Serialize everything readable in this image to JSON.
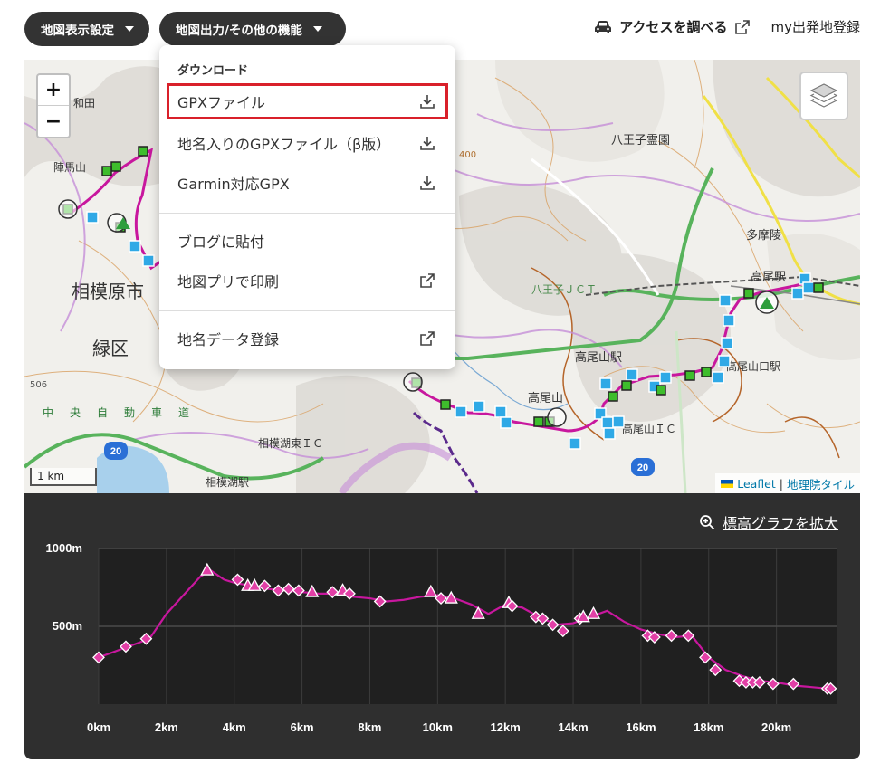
{
  "toolbar": {
    "map_settings_label": "地図表示設定",
    "output_label": "地図出力/その他の機能",
    "access_label": "アクセスを調べる",
    "my_start_label": "my出発地登録"
  },
  "map": {
    "zoom_in": "+",
    "zoom_out": "−",
    "scale_label": "1 km",
    "attribution": {
      "leaflet": "Leaflet",
      "separator": "|",
      "tiles": "地理院タイル"
    },
    "labels": [
      "八王子霊園",
      "多摩陵",
      "相模原市",
      "緑区",
      "高尾駅",
      "八王子ＪＣＴ",
      "高尾山駅",
      "高尾山",
      "高尾山口駅",
      "高尾山ＩＣ",
      "相模湖東ＩＣ",
      "相模湖駅",
      "中央自動車道",
      "陣馬山",
      "和田",
      "400",
      "506",
      "20",
      "20"
    ]
  },
  "dropdown": {
    "heading": "ダウンロード",
    "items": [
      {
        "label": "GPXファイル",
        "icon": "download-icon"
      },
      {
        "label": "地名入りのGPXファイル（β版）",
        "icon": "download-icon"
      },
      {
        "label": "Garmin対応GPX",
        "icon": "download-icon"
      },
      {
        "label": "ブログに貼付",
        "icon": ""
      },
      {
        "label": "地図プリで印刷",
        "icon": "external-link-icon"
      },
      {
        "label": "地名データ登録",
        "icon": "external-link-icon"
      }
    ]
  },
  "profile": {
    "enlarge_label": "標高グラフを拡大"
  },
  "chart_data": {
    "type": "line",
    "ylim": [
      0,
      1000
    ],
    "xlim": [
      0,
      21.8
    ],
    "yticks": [
      "1000m",
      "500m"
    ],
    "ytick_values": [
      1000,
      500
    ],
    "xticks": [
      "0km",
      "2km",
      "4km",
      "6km",
      "8km",
      "10km",
      "12km",
      "14km",
      "16km",
      "18km",
      "20km"
    ],
    "xtick_values": [
      0,
      2,
      4,
      6,
      8,
      10,
      12,
      14,
      16,
      18,
      20
    ],
    "series": [
      {
        "x": [
          0,
          0.5,
          1.0,
          1.5,
          2.0,
          2.5,
          3.0,
          3.3,
          3.7,
          4.0,
          4.5,
          5.0,
          5.5,
          6.0,
          6.5,
          7.0,
          7.5,
          8.0,
          8.5,
          9.0,
          9.5,
          10.0,
          10.5,
          11.0,
          11.5,
          12.0,
          12.5,
          13.0,
          13.5,
          14.0,
          14.5,
          15.0,
          15.5,
          16.0,
          16.5,
          17.0,
          17.5,
          18.0,
          18.5,
          19.0,
          19.5,
          20.0,
          20.5,
          21.0,
          21.5
        ],
        "y": [
          300,
          340,
          380,
          420,
          580,
          700,
          820,
          860,
          800,
          780,
          760,
          740,
          730,
          720,
          710,
          710,
          690,
          680,
          660,
          670,
          690,
          700,
          680,
          640,
          580,
          640,
          620,
          560,
          510,
          520,
          560,
          600,
          530,
          480,
          450,
          430,
          440,
          300,
          220,
          180,
          150,
          140,
          120,
          110,
          100
        ]
      }
    ],
    "markers": [
      {
        "x": 0,
        "y": 300,
        "shape": "diamond"
      },
      {
        "x": 0.8,
        "y": 370,
        "shape": "diamond"
      },
      {
        "x": 1.4,
        "y": 420,
        "shape": "diamond"
      },
      {
        "x": 3.2,
        "y": 860,
        "shape": "triangle"
      },
      {
        "x": 4.1,
        "y": 800,
        "shape": "diamond"
      },
      {
        "x": 4.4,
        "y": 760,
        "shape": "triangle"
      },
      {
        "x": 4.6,
        "y": 760,
        "shape": "triangle"
      },
      {
        "x": 4.9,
        "y": 760,
        "shape": "diamond"
      },
      {
        "x": 5.3,
        "y": 730,
        "shape": "diamond"
      },
      {
        "x": 5.6,
        "y": 740,
        "shape": "diamond"
      },
      {
        "x": 5.9,
        "y": 730,
        "shape": "diamond"
      },
      {
        "x": 6.3,
        "y": 720,
        "shape": "triangle"
      },
      {
        "x": 6.9,
        "y": 720,
        "shape": "diamond"
      },
      {
        "x": 7.2,
        "y": 730,
        "shape": "triangle"
      },
      {
        "x": 7.4,
        "y": 710,
        "shape": "diamond"
      },
      {
        "x": 8.3,
        "y": 660,
        "shape": "diamond"
      },
      {
        "x": 9.8,
        "y": 720,
        "shape": "triangle"
      },
      {
        "x": 10.1,
        "y": 680,
        "shape": "diamond"
      },
      {
        "x": 10.4,
        "y": 680,
        "shape": "triangle"
      },
      {
        "x": 11.2,
        "y": 580,
        "shape": "triangle"
      },
      {
        "x": 12.1,
        "y": 650,
        "shape": "triangle"
      },
      {
        "x": 12.2,
        "y": 630,
        "shape": "diamond"
      },
      {
        "x": 12.9,
        "y": 560,
        "shape": "diamond"
      },
      {
        "x": 13.1,
        "y": 550,
        "shape": "diamond"
      },
      {
        "x": 13.4,
        "y": 510,
        "shape": "diamond"
      },
      {
        "x": 13.7,
        "y": 470,
        "shape": "diamond"
      },
      {
        "x": 14.2,
        "y": 550,
        "shape": "diamond"
      },
      {
        "x": 14.3,
        "y": 560,
        "shape": "triangle"
      },
      {
        "x": 14.6,
        "y": 580,
        "shape": "triangle"
      },
      {
        "x": 16.2,
        "y": 440,
        "shape": "diamond"
      },
      {
        "x": 16.4,
        "y": 430,
        "shape": "diamond"
      },
      {
        "x": 16.9,
        "y": 440,
        "shape": "diamond"
      },
      {
        "x": 17.4,
        "y": 440,
        "shape": "diamond"
      },
      {
        "x": 17.9,
        "y": 300,
        "shape": "diamond"
      },
      {
        "x": 18.2,
        "y": 220,
        "shape": "diamond"
      },
      {
        "x": 18.9,
        "y": 150,
        "shape": "diamond"
      },
      {
        "x": 19.1,
        "y": 140,
        "shape": "diamond"
      },
      {
        "x": 19.3,
        "y": 140,
        "shape": "diamond"
      },
      {
        "x": 19.5,
        "y": 140,
        "shape": "diamond"
      },
      {
        "x": 19.9,
        "y": 130,
        "shape": "diamond"
      },
      {
        "x": 20.5,
        "y": 130,
        "shape": "diamond"
      },
      {
        "x": 21.5,
        "y": 100,
        "shape": "diamond"
      },
      {
        "x": 21.6,
        "y": 100,
        "shape": "diamond"
      }
    ]
  },
  "colors": {
    "route": "#c8179e",
    "marker_fill": "#e23fa6",
    "highlight": "#d9202a",
    "dark_panel": "#2f2f2f",
    "pill": "#333333"
  }
}
